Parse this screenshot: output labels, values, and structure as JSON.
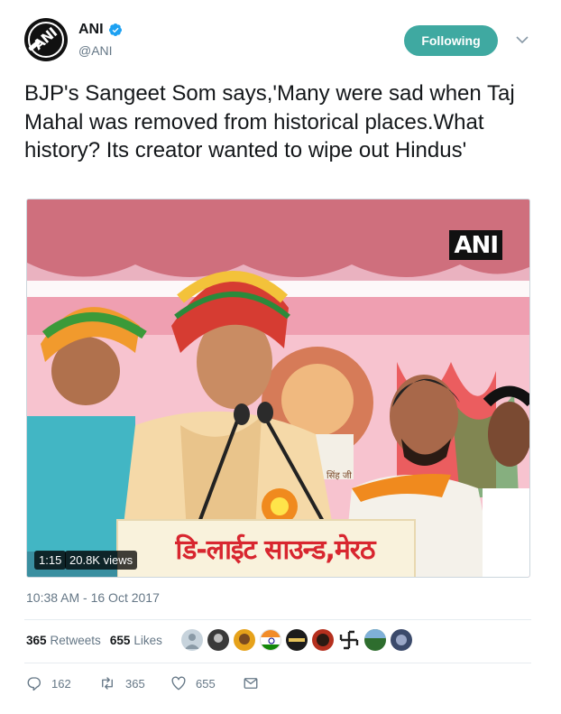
{
  "account": {
    "name": "ANI",
    "handle": "@ANI",
    "verified_icon": "verified-badge-icon",
    "logo_text": "ANI"
  },
  "follow_button": {
    "label": "Following",
    "color": "#3fa9a1"
  },
  "tweet": {
    "text": "BJP's Sangeet Som says,'Many were sad when Taj Mahal was removed from historical places.What history? Its creator wanted to wipe out Hindus'",
    "timestamp": "10:38 AM - 16 Oct 2017"
  },
  "video": {
    "watermark": "ANI",
    "duration": "1:15",
    "views": "20.8K views",
    "banner_text": "डि-लाईट साउन्ड,मेरठ",
    "poster_text": "सिंह जी"
  },
  "stats": {
    "retweets_count": "365",
    "retweets_label": "Retweets",
    "likes_count": "655",
    "likes_label": "Likes"
  },
  "actions": {
    "replies": "162",
    "retweets": "365",
    "likes": "655"
  },
  "colors": {
    "text": "#14171a",
    "secondary": "#657786",
    "divider": "#e6ecf0",
    "verified": "#1da1f2"
  }
}
